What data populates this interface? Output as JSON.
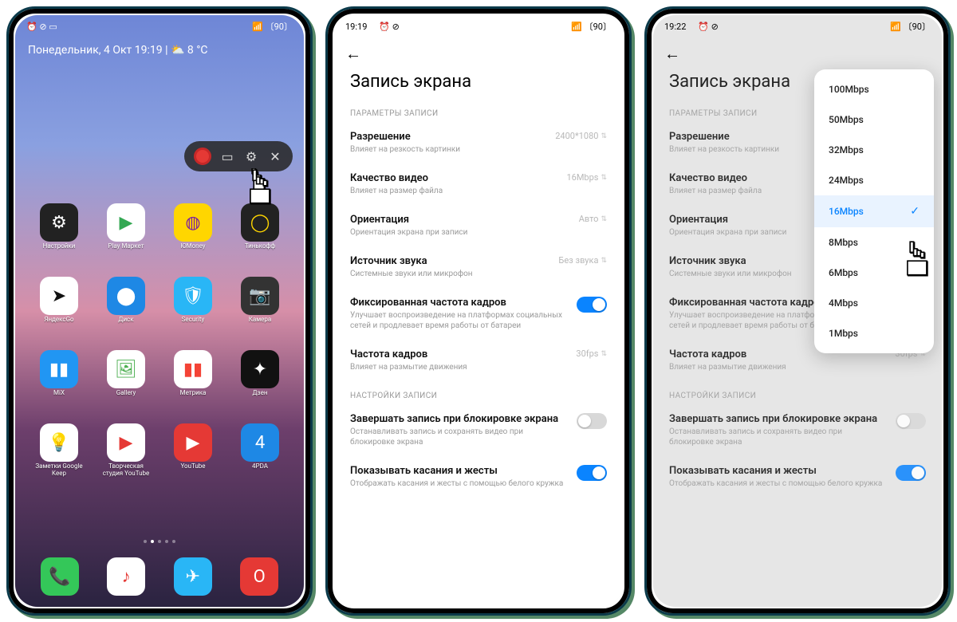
{
  "phone1": {
    "status_time": "",
    "status_icons_left": "⏰ ⊘ ▭",
    "status_icons_right": "📶 〔90〕",
    "date_weather": "Понедельник, 4 Окт  19:19  |  ⛅ 8 °C",
    "apps_row1": [
      {
        "label": "Настройки",
        "bg": "#222",
        "glyph": "⚙",
        "fg": "#fff"
      },
      {
        "label": "Play Маркет",
        "bg": "#fff",
        "glyph": "▶",
        "fg": "#34a853"
      },
      {
        "label": "ЮMoney",
        "bg": "#ffd600",
        "glyph": "◍",
        "fg": "#7b1fa2"
      },
      {
        "label": "Тинькофф",
        "bg": "#222",
        "glyph": "◯",
        "fg": "#ffd600"
      }
    ],
    "apps_row2": [
      {
        "label": "ЯндексGo",
        "bg": "#fff",
        "glyph": "➤",
        "fg": "#111"
      },
      {
        "label": "Диск",
        "bg": "#1e88e5",
        "glyph": "⬤",
        "fg": "#fff"
      },
      {
        "label": "Security",
        "bg": "#29b6f6",
        "glyph": "🛡",
        "fg": "#fff"
      },
      {
        "label": "Камера",
        "bg": "#333",
        "glyph": "📷",
        "fg": "#fff"
      }
    ],
    "apps_row3": [
      {
        "label": "MiX",
        "bg": "#2196f3",
        "glyph": "▮▮",
        "fg": "#fff"
      },
      {
        "label": "Gallery",
        "bg": "#fff",
        "glyph": "🖼",
        "fg": "#4caf50"
      },
      {
        "label": "Метрика",
        "bg": "#fff",
        "glyph": "▮▮",
        "fg": "#f44336"
      },
      {
        "label": "Дзен",
        "bg": "#111",
        "glyph": "✦",
        "fg": "#fff"
      }
    ],
    "apps_row4": [
      {
        "label": "Заметки Google Keep",
        "bg": "#fff",
        "glyph": "💡",
        "fg": "#fbc02d"
      },
      {
        "label": "Творческая студия YouTube",
        "bg": "#fff",
        "glyph": "▶",
        "fg": "#e53935"
      },
      {
        "label": "YouTube",
        "bg": "#e53935",
        "glyph": "▶",
        "fg": "#fff"
      },
      {
        "label": "4PDA",
        "bg": "#1e88e5",
        "glyph": "4",
        "fg": "#fff"
      }
    ],
    "dock": [
      {
        "bg": "#34c759",
        "glyph": "📞",
        "fg": "#fff"
      },
      {
        "bg": "#fff",
        "glyph": "♪",
        "fg": "#e53935"
      },
      {
        "bg": "#29b6f6",
        "glyph": "✈",
        "fg": "#fff"
      },
      {
        "bg": "#e53935",
        "glyph": "O",
        "fg": "#fff"
      }
    ]
  },
  "phone2": {
    "status_time": "19:19",
    "status_icons_left": "⏰ ⊘",
    "status_icons_right": "📶 〔90〕",
    "title": "Запись экрана",
    "section1": "ПАРАМЕТРЫ ЗАПИСИ",
    "rows1": [
      {
        "title": "Разрешение",
        "sub": "Влияет на резкость картинки",
        "value": "2400*1080"
      },
      {
        "title": "Качество видео",
        "sub": "Влияет на размер файла",
        "value": "16Mbps"
      },
      {
        "title": "Ориентация",
        "sub": "Ориентация экрана при записи",
        "value": "Авто"
      },
      {
        "title": "Источник звука",
        "sub": "Системные звуки или микрофон",
        "value": "Без звука"
      }
    ],
    "toggle1": {
      "title": "Фиксированная частота кадров",
      "sub": "Улучшает воспроизведение на платформах социальных сетей и продлевает время работы от батареи",
      "on": true
    },
    "fps": {
      "title": "Частота кадров",
      "sub": "Влияет на размытие движения",
      "value": "30fps"
    },
    "section2": "НАСТРОЙКИ ЗАПИСИ",
    "toggle2": {
      "title": "Завершать запись при блокировке экрана",
      "sub": "Останавливать запись и сохранять видео при блокировке экрана",
      "on": false
    },
    "toggle3": {
      "title": "Показывать касания и жесты",
      "sub": "Отображать касания и жесты с помощью белого кружка",
      "on": true
    }
  },
  "phone3": {
    "status_time": "19:22",
    "status_icons_left": "⏰ ⊘",
    "status_icons_right": "📶 〔90〕",
    "dropdown": [
      "100Mbps",
      "50Mbps",
      "32Mbps",
      "24Mbps",
      "16Mbps",
      "8Mbps",
      "6Mbps",
      "4Mbps",
      "1Mbps"
    ],
    "selected": "16Mbps"
  }
}
